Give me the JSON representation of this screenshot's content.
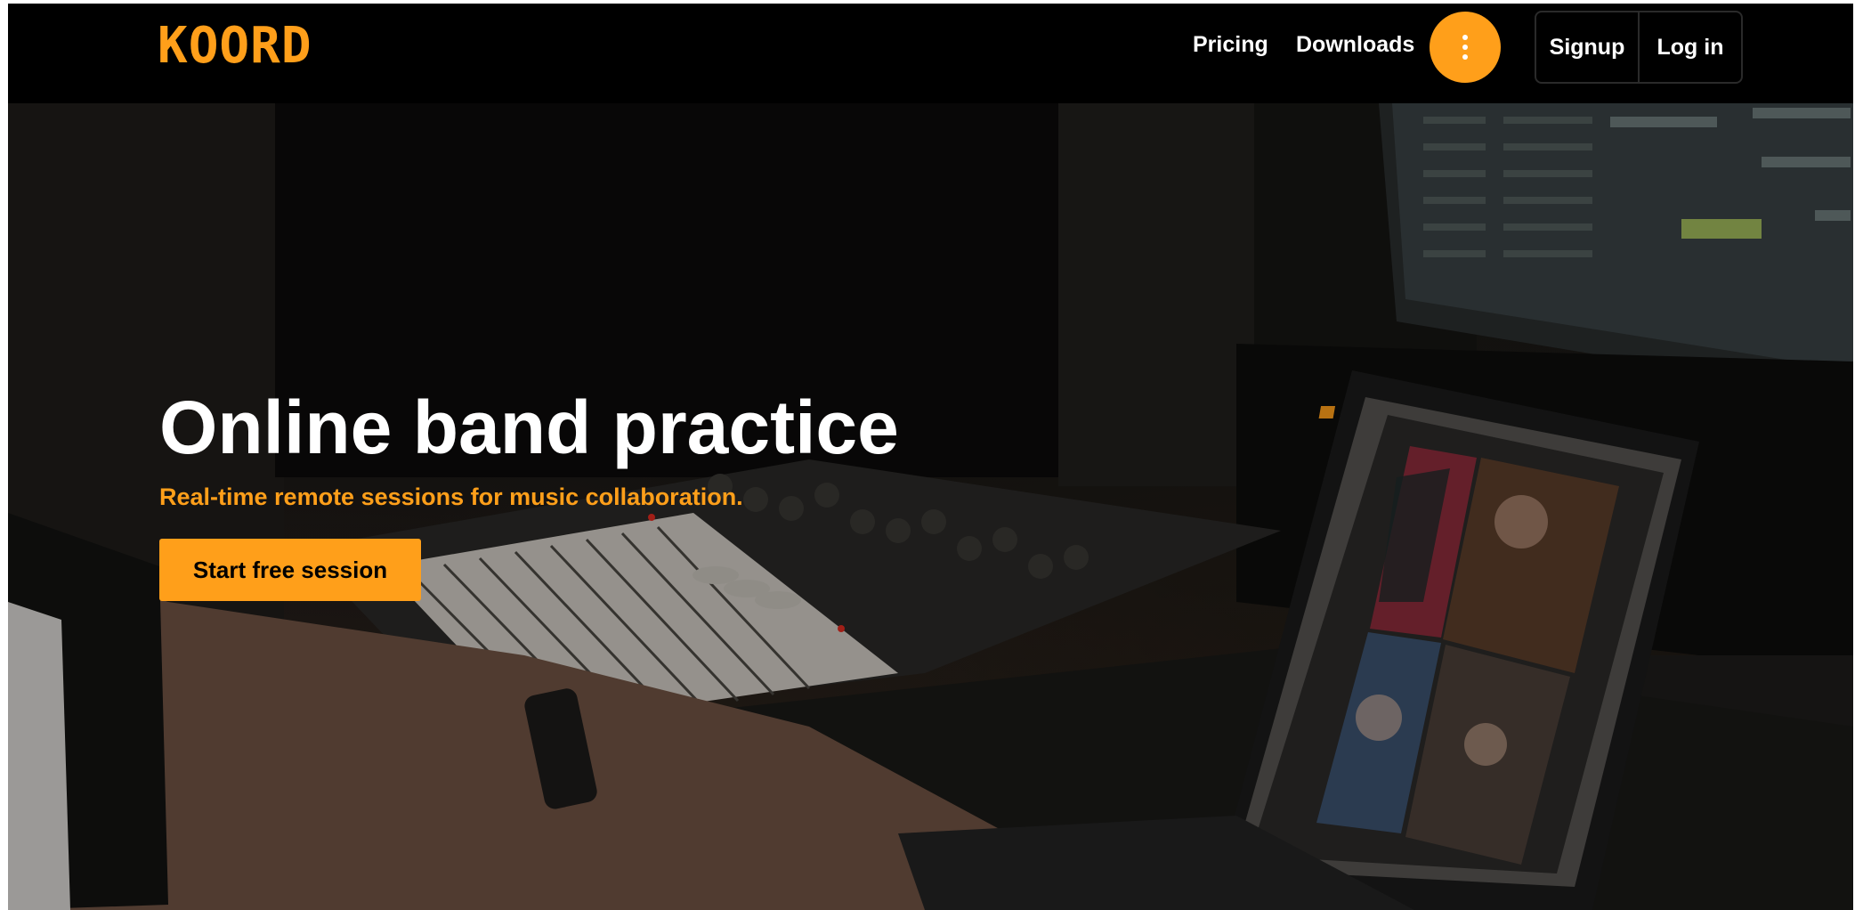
{
  "brand": {
    "logo": "KOORD",
    "accent": "#ff9f1a"
  },
  "nav": {
    "pricing": "Pricing",
    "downloads": "Downloads",
    "more_icon": "vertical-ellipsis-icon",
    "signup": "Signup",
    "login": "Log in"
  },
  "hero": {
    "title": "Online band practice",
    "subtitle": "Real-time remote sessions for music collaboration.",
    "cta": "Start free session"
  }
}
